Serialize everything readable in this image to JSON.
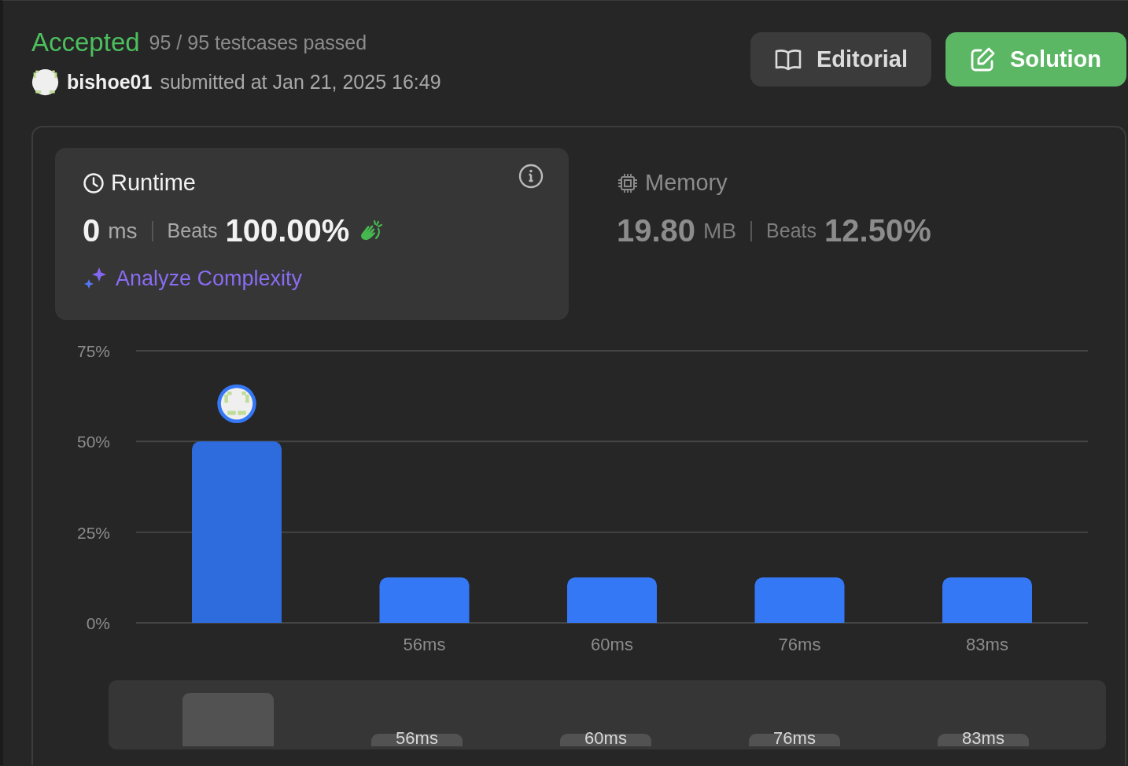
{
  "header": {
    "status": "Accepted",
    "testcases": "95 / 95 testcases passed",
    "user": "bishoe01",
    "submitted": "submitted at Jan 21, 2025 16:49"
  },
  "buttons": [
    {
      "label": "Editorial",
      "kind": "editorial"
    },
    {
      "label": "Solution",
      "kind": "solution"
    }
  ],
  "stats": [
    {
      "kind": "runtime",
      "title": "Runtime",
      "selected": true,
      "value": "0",
      "unit": "ms",
      "beats_label": "Beats",
      "beats": "100.00%",
      "link": "Analyze Complexity"
    },
    {
      "kind": "memory",
      "title": "Memory",
      "selected": false,
      "value": "19.80",
      "unit": "MB",
      "beats_label": "Beats",
      "beats": "12.50%"
    }
  ],
  "chart_data": {
    "type": "bar",
    "categories": [
      null,
      "56ms",
      "60ms",
      "76ms",
      "83ms"
    ],
    "series": [
      {
        "color": "#2e6bdc",
        "values": [
          50,
          null,
          null,
          null,
          null
        ]
      },
      {
        "color": "#3478f6",
        "values": [
          null,
          12.5,
          12.5,
          12.5,
          12.5
        ]
      }
    ],
    "ylim": [
      0,
      75
    ],
    "yticks": [
      {
        "value": 0,
        "label": "0%"
      },
      {
        "value": 25,
        "label": "25%"
      },
      {
        "value": 50,
        "label": "50%"
      },
      {
        "value": 75,
        "label": "75%"
      }
    ]
  },
  "range_selector": {
    "items": [
      {
        "kind": "bar"
      },
      {
        "kind": "labeled-bar",
        "label": "56ms"
      },
      {
        "kind": "labeled-bar",
        "label": "60ms"
      },
      {
        "kind": "labeled-bar",
        "label": "76ms"
      },
      {
        "kind": "labeled-bar",
        "label": "83ms"
      }
    ]
  }
}
